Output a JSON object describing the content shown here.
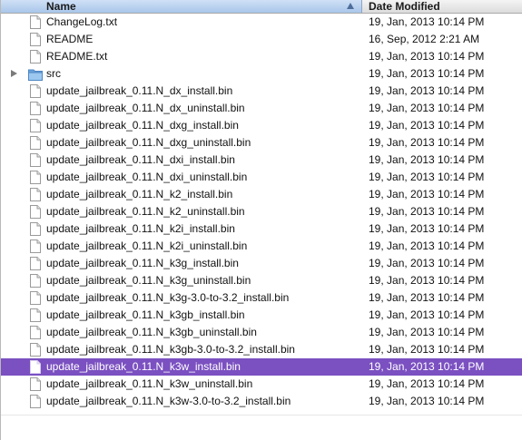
{
  "header": {
    "name_label": "Name",
    "date_label": "Date Modified"
  },
  "rows": [
    {
      "name": "ChangeLog.txt",
      "date": "19, Jan, 2013 10:14 PM",
      "icon": "document-icon"
    },
    {
      "name": "README",
      "date": "16, Sep, 2012 2:21 AM",
      "icon": "document-icon"
    },
    {
      "name": "README.txt",
      "date": "19, Jan, 2013 10:14 PM",
      "icon": "document-icon"
    },
    {
      "name": "src",
      "date": "19, Jan, 2013 10:14 PM",
      "icon": "folder-icon",
      "folder": true
    },
    {
      "name": "update_jailbreak_0.11.N_dx_install.bin",
      "date": "19, Jan, 2013 10:14 PM",
      "icon": "document-icon"
    },
    {
      "name": "update_jailbreak_0.11.N_dx_uninstall.bin",
      "date": "19, Jan, 2013 10:14 PM",
      "icon": "document-icon"
    },
    {
      "name": "update_jailbreak_0.11.N_dxg_install.bin",
      "date": "19, Jan, 2013 10:14 PM",
      "icon": "document-icon"
    },
    {
      "name": "update_jailbreak_0.11.N_dxg_uninstall.bin",
      "date": "19, Jan, 2013 10:14 PM",
      "icon": "document-icon"
    },
    {
      "name": "update_jailbreak_0.11.N_dxi_install.bin",
      "date": "19, Jan, 2013 10:14 PM",
      "icon": "document-icon"
    },
    {
      "name": "update_jailbreak_0.11.N_dxi_uninstall.bin",
      "date": "19, Jan, 2013 10:14 PM",
      "icon": "document-icon"
    },
    {
      "name": "update_jailbreak_0.11.N_k2_install.bin",
      "date": "19, Jan, 2013 10:14 PM",
      "icon": "document-icon"
    },
    {
      "name": "update_jailbreak_0.11.N_k2_uninstall.bin",
      "date": "19, Jan, 2013 10:14 PM",
      "icon": "document-icon"
    },
    {
      "name": "update_jailbreak_0.11.N_k2i_install.bin",
      "date": "19, Jan, 2013 10:14 PM",
      "icon": "document-icon"
    },
    {
      "name": "update_jailbreak_0.11.N_k2i_uninstall.bin",
      "date": "19, Jan, 2013 10:14 PM",
      "icon": "document-icon"
    },
    {
      "name": "update_jailbreak_0.11.N_k3g_install.bin",
      "date": "19, Jan, 2013 10:14 PM",
      "icon": "document-icon"
    },
    {
      "name": "update_jailbreak_0.11.N_k3g_uninstall.bin",
      "date": "19, Jan, 2013 10:14 PM",
      "icon": "document-icon"
    },
    {
      "name": "update_jailbreak_0.11.N_k3g-3.0-to-3.2_install.bin",
      "date": "19, Jan, 2013 10:14 PM",
      "icon": "document-icon"
    },
    {
      "name": "update_jailbreak_0.11.N_k3gb_install.bin",
      "date": "19, Jan, 2013 10:14 PM",
      "icon": "document-icon"
    },
    {
      "name": "update_jailbreak_0.11.N_k3gb_uninstall.bin",
      "date": "19, Jan, 2013 10:14 PM",
      "icon": "document-icon"
    },
    {
      "name": "update_jailbreak_0.11.N_k3gb-3.0-to-3.2_install.bin",
      "date": "19, Jan, 2013 10:14 PM",
      "icon": "document-icon"
    },
    {
      "name": "update_jailbreak_0.11.N_k3w_install.bin",
      "date": "19, Jan, 2013 10:14 PM",
      "icon": "document-icon",
      "selected": true
    },
    {
      "name": "update_jailbreak_0.11.N_k3w_uninstall.bin",
      "date": "19, Jan, 2013 10:14 PM",
      "icon": "document-icon"
    },
    {
      "name": "update_jailbreak_0.11.N_k3w-3.0-to-3.2_install.bin",
      "date": "19, Jan, 2013 10:14 PM",
      "icon": "document-icon"
    }
  ],
  "colors": {
    "selection": "#7b50c1",
    "folder": "#7fb2e3",
    "sorted_header": "#a9c6ea"
  }
}
